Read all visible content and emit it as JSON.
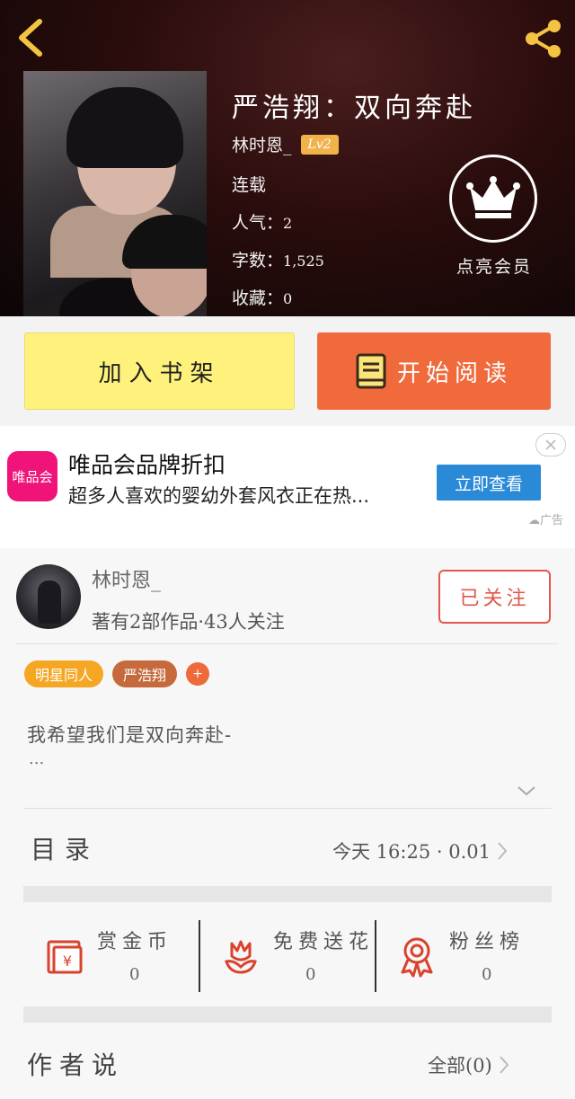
{
  "header": {
    "book_title": "严浩翔：双向奔赴",
    "author": "林时恩_",
    "level": "Lv2",
    "status": "连载",
    "popularity_label": "人气：",
    "popularity_value": "2",
    "word_count_label": "字数：",
    "word_count_value": "1,525",
    "favorites_label": "收藏：",
    "favorites_value": "0",
    "vip_label": "点亮会员"
  },
  "actions": {
    "add_to_shelf": "加入书架",
    "start_reading": "开始阅读"
  },
  "ad": {
    "logo_text": "唯品会",
    "title": "唯品会品牌折扣",
    "description": "超多人喜欢的婴幼外套风衣正在热...",
    "button": "立即查看",
    "tag": "广告"
  },
  "author_card": {
    "name": "林时恩_",
    "stats": "著有2部作品·43人关注",
    "follow_button": "已关注",
    "tags": [
      "明星同人",
      "严浩翔"
    ],
    "add_tag": "+",
    "description": "我希望我们是双向奔赴-",
    "description_more": "..."
  },
  "toc": {
    "title": "目录",
    "info": "今天 16:25 · 0.01"
  },
  "stats": [
    {
      "label": "赏金币",
      "value": "0"
    },
    {
      "label": "免费送花",
      "value": "0"
    },
    {
      "label": "粉丝榜",
      "value": "0"
    }
  ],
  "author_says": {
    "title": "作者说",
    "all": "全部(0)"
  },
  "colors": {
    "accent_orange": "#f06a3c",
    "shelf_yellow": "#fff27c",
    "follow_red": "#e1584a",
    "level_badge": "#f2b24a",
    "ad_button": "#2a8ad8",
    "ad_logo": "#f0147a"
  }
}
